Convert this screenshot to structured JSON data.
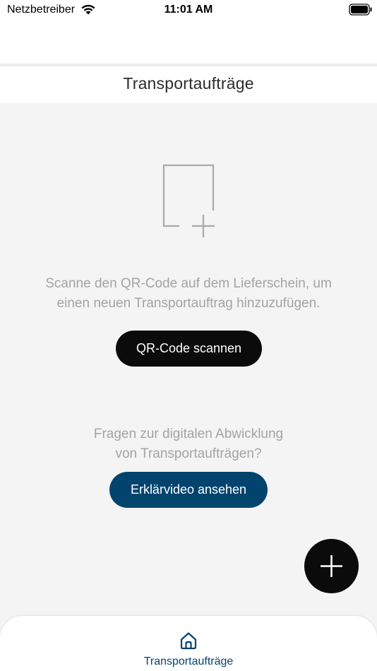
{
  "status_bar": {
    "carrier": "Netzbetreiber",
    "time": "11:01 AM",
    "wifi_icon": "wifi-icon",
    "battery_icon": "battery-icon"
  },
  "header": {
    "title": "Transportaufträge"
  },
  "empty_state": {
    "illustration_icon": "document-add-icon",
    "line1": "Scanne den QR-Code auf dem Lieferschein, um",
    "line2": "einen neuen Transportauftrag hinzuzufügen.",
    "scan_button_label": "QR-Code scannen"
  },
  "help": {
    "line1": "Fragen zur digitalen Abwicklung",
    "line2": "von Transportaufträgen?",
    "video_button_label": "Erklärvideo ansehen"
  },
  "fab": {
    "icon": "plus-icon"
  },
  "bottom_nav": {
    "items": [
      {
        "label": "Transportaufträge",
        "icon": "home-icon",
        "active": true
      }
    ]
  },
  "colors": {
    "background": "#f4f4f4",
    "primary_button": "#0b0b0b",
    "accent": "#03446e",
    "muted_text": "#a3a3a3"
  }
}
